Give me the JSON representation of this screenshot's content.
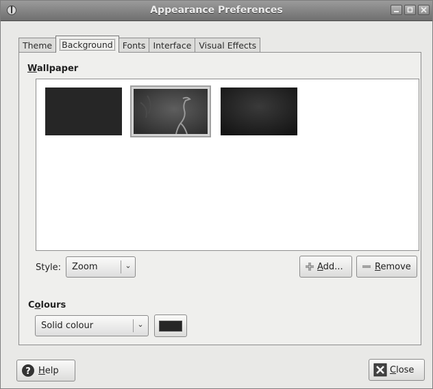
{
  "window": {
    "title": "Appearance Preferences",
    "icon": "appearance-icon",
    "controls": [
      "minimize-icon",
      "maximize-icon",
      "close-icon"
    ]
  },
  "tabs": [
    {
      "label": "Theme"
    },
    {
      "label": "Background",
      "active": true
    },
    {
      "label": "Fonts"
    },
    {
      "label": "Interface"
    },
    {
      "label": "Visual Effects"
    }
  ],
  "wallpaper": {
    "heading_mnemonic": "W",
    "heading_rest": "allpaper",
    "thumbnails": [
      {
        "name": "dark-solid",
        "selected": false
      },
      {
        "name": "heron",
        "selected": true
      },
      {
        "name": "dark-texture",
        "selected": false
      }
    ]
  },
  "style": {
    "label": "Style:",
    "value": "Zoom"
  },
  "add_button": {
    "label_mnemonic": "A",
    "label_rest": "dd...",
    "icon": "plus-icon"
  },
  "remove_button": {
    "label_mnemonic": "R",
    "label_rest": "emove",
    "icon": "minus-icon"
  },
  "colours": {
    "heading_pre": "C",
    "heading_mnemonic": "o",
    "heading_rest": "lours",
    "mode": "Solid colour",
    "color": "#262626"
  },
  "help_button": {
    "label_mnemonic": "H",
    "label_rest": "elp",
    "icon": "help-icon"
  },
  "close_button": {
    "label_mnemonic": "C",
    "label_rest": "lose",
    "icon": "close-icon"
  }
}
